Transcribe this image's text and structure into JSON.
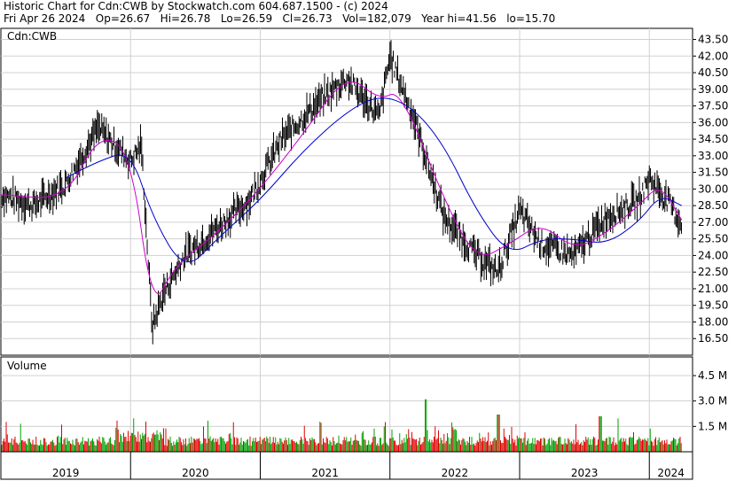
{
  "header": {
    "line1": "Historic Chart for Cdn:CWB by Stockwatch.com 604.687.1500 - (c) 2024",
    "line2": "Fri Apr 26 2024   Op=26.67   Hi=26.78   Lo=26.59   Cl=26.73   Vol=182,079   Year hi=41.56   lo=15.70"
  },
  "chart_data": [
    {
      "type": "candlestick-line",
      "title": "Cdn:CWB",
      "ylim": [
        15.0,
        44.5
      ],
      "y_ticks": [
        "16.50",
        "18.00",
        "19.50",
        "21.00",
        "22.50",
        "24.00",
        "25.50",
        "27.00",
        "28.50",
        "30.00",
        "31.50",
        "33.00",
        "34.50",
        "36.00",
        "37.50",
        "39.00",
        "40.50",
        "42.00",
        "43.50"
      ],
      "x_labels": [
        "2019",
        "2020",
        "2021",
        "2022",
        "2023",
        "2024"
      ],
      "grid": true,
      "series": [
        {
          "name": "",
          "role": "price",
          "color": "#000000",
          "x": [
            "2019-01",
            "2019-04",
            "2019-07",
            "2019-10",
            "2020-01",
            "2020-02",
            "2020-03",
            "2020-04",
            "2020-06",
            "2020-09",
            "2020-12",
            "2021-03",
            "2021-06",
            "2021-09",
            "2021-12",
            "2022-01",
            "2022-03",
            "2022-06",
            "2022-09",
            "2022-11",
            "2023-01",
            "2023-03",
            "2023-06",
            "2023-09",
            "2023-12",
            "2024-01",
            "2024-03",
            "2024-04"
          ],
          "values": [
            29.5,
            28.5,
            30.5,
            35.5,
            32.5,
            34.0,
            17.5,
            20.5,
            24.0,
            26.5,
            29.0,
            34.5,
            37.5,
            40.0,
            36.5,
            42.0,
            37.0,
            27.5,
            24.0,
            22.5,
            28.0,
            25.0,
            24.0,
            27.5,
            29.0,
            31.0,
            28.5,
            26.7
          ]
        },
        {
          "name": "",
          "role": "short-ma",
          "color": "#cc00cc",
          "x": [
            "2019-01",
            "2019-07",
            "2019-10",
            "2020-01",
            "2020-03",
            "2020-05",
            "2020-09",
            "2021-01",
            "2021-05",
            "2021-09",
            "2021-12",
            "2022-02",
            "2022-06",
            "2022-09",
            "2022-12",
            "2023-03",
            "2023-06",
            "2023-09",
            "2023-12",
            "2024-02",
            "2024-04"
          ],
          "values": [
            29.5,
            29.0,
            35.0,
            33.5,
            19.0,
            23.0,
            26.0,
            30.0,
            35.0,
            40.5,
            38.0,
            39.0,
            29.0,
            23.5,
            25.0,
            27.0,
            24.5,
            26.0,
            28.5,
            30.5,
            27.2
          ]
        },
        {
          "name": "",
          "role": "long-ma",
          "color": "#0000cc",
          "x": [
            "2019-07",
            "2019-10",
            "2020-01",
            "2020-03",
            "2020-06",
            "2020-09",
            "2021-01",
            "2021-05",
            "2021-09",
            "2021-12",
            "2022-03",
            "2022-06",
            "2022-09",
            "2022-12",
            "2023-03",
            "2023-06",
            "2023-09",
            "2023-12",
            "2024-02",
            "2024-04"
          ],
          "values": [
            31.0,
            32.5,
            33.5,
            27.5,
            22.5,
            25.5,
            29.0,
            33.5,
            37.0,
            38.5,
            37.5,
            34.0,
            28.0,
            24.0,
            25.5,
            25.5,
            25.0,
            27.0,
            29.5,
            28.5
          ]
        }
      ]
    },
    {
      "type": "bar",
      "title": "Volume",
      "y_ticks": [
        "1.5 M",
        "3.0 M",
        "4.5 M"
      ],
      "colors": {
        "up": "#00a000",
        "down": "#e00000"
      }
    }
  ]
}
